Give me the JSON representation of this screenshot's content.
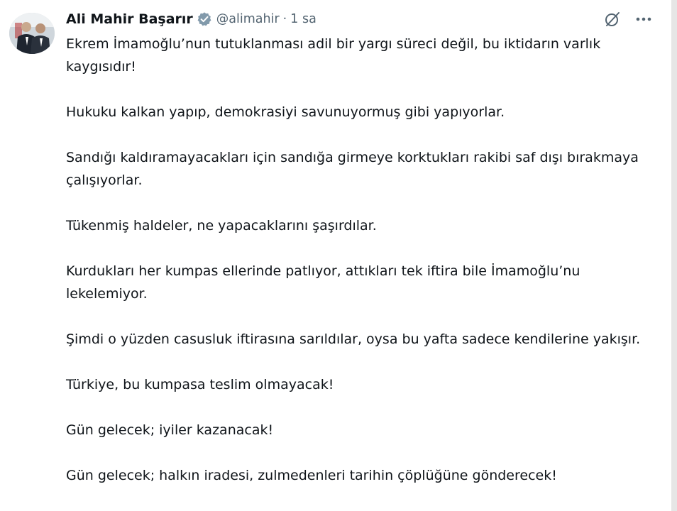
{
  "tweet": {
    "author": {
      "display_name": "Ali Mahir Başarır",
      "handle": "@alimahir",
      "verified": true
    },
    "separator": "·",
    "time": "1 sa",
    "colors": {
      "text": "#0f1419",
      "secondary_text": "#536471",
      "verified_badge": "#829aab"
    },
    "icons": {
      "verified": "verified-badge-icon",
      "grok": "grok-icon",
      "more": "more-icon"
    },
    "paragraphs": [
      "Ekrem İmamoğlu’nun tutuklanması adil bir yargı süreci değil, bu iktidarın varlık kaygısıdır!",
      "Hukuku kalkan yapıp, demokrasiyi savunuyormuş gibi yapıyorlar.",
      "Sandığı kaldıramayacakları için sandığa girmeye korktukları rakibi saf dışı bırakmaya çalışıyorlar.",
      "Tükenmiş haldeler, ne yapacaklarını şaşırdılar.",
      "Kurdukları her kumpas ellerinde patlıyor, attıkları tek iftira bile İmamoğlu’nu lekelemiyor.",
      "Şimdi o yüzden casusluk iftirasına sarıldılar, oysa bu yafta sadece kendilerine yakışır.",
      "Türkiye, bu kumpasa teslim olmayacak!",
      "Gün gelecek; iyiler kazanacak!",
      "Gün gelecek; halkın iradesi, zulmedenleri tarihin çöplüğüne gönderecek!"
    ]
  }
}
